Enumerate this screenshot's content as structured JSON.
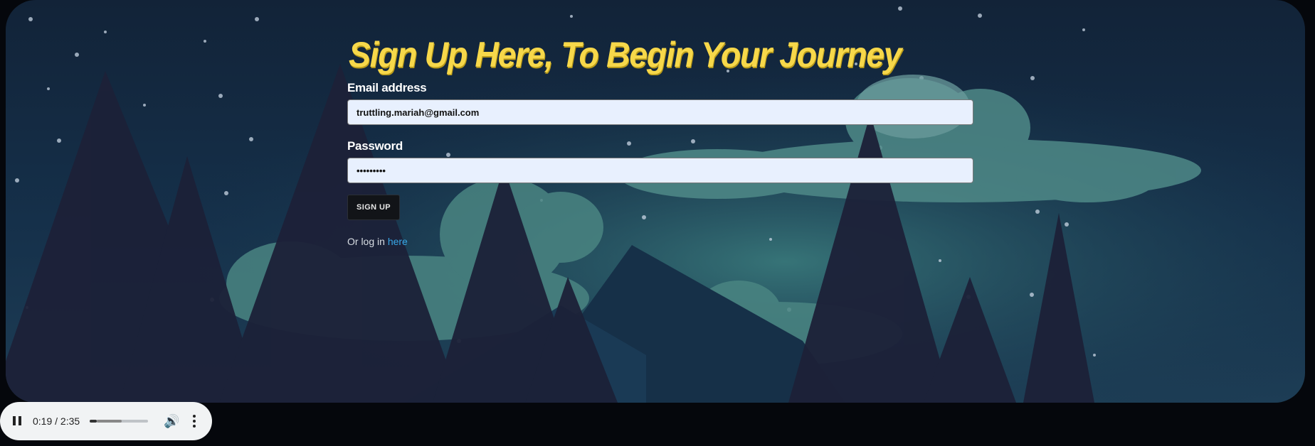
{
  "form": {
    "title": "Sign Up Here, To Begin Your Journey",
    "email_label": "Email address",
    "email_value": "truttling.mariah@gmail.com",
    "password_label": "Password",
    "password_value": "•••••••••",
    "signup_label": "SIGN UP",
    "login_prefix": "Or log in ",
    "login_link": "here"
  },
  "player": {
    "time": "0:19 / 2:35",
    "progress_fraction": 0.12,
    "buffered_fraction": 0.55,
    "play_state_icon": "pause-icon",
    "volume_icon": "volume-icon",
    "menu_icon": "more-vert-icon"
  },
  "colors": {
    "title": "#f7d84a",
    "link": "#38a8e8",
    "input_bg": "#e8f0fe"
  }
}
